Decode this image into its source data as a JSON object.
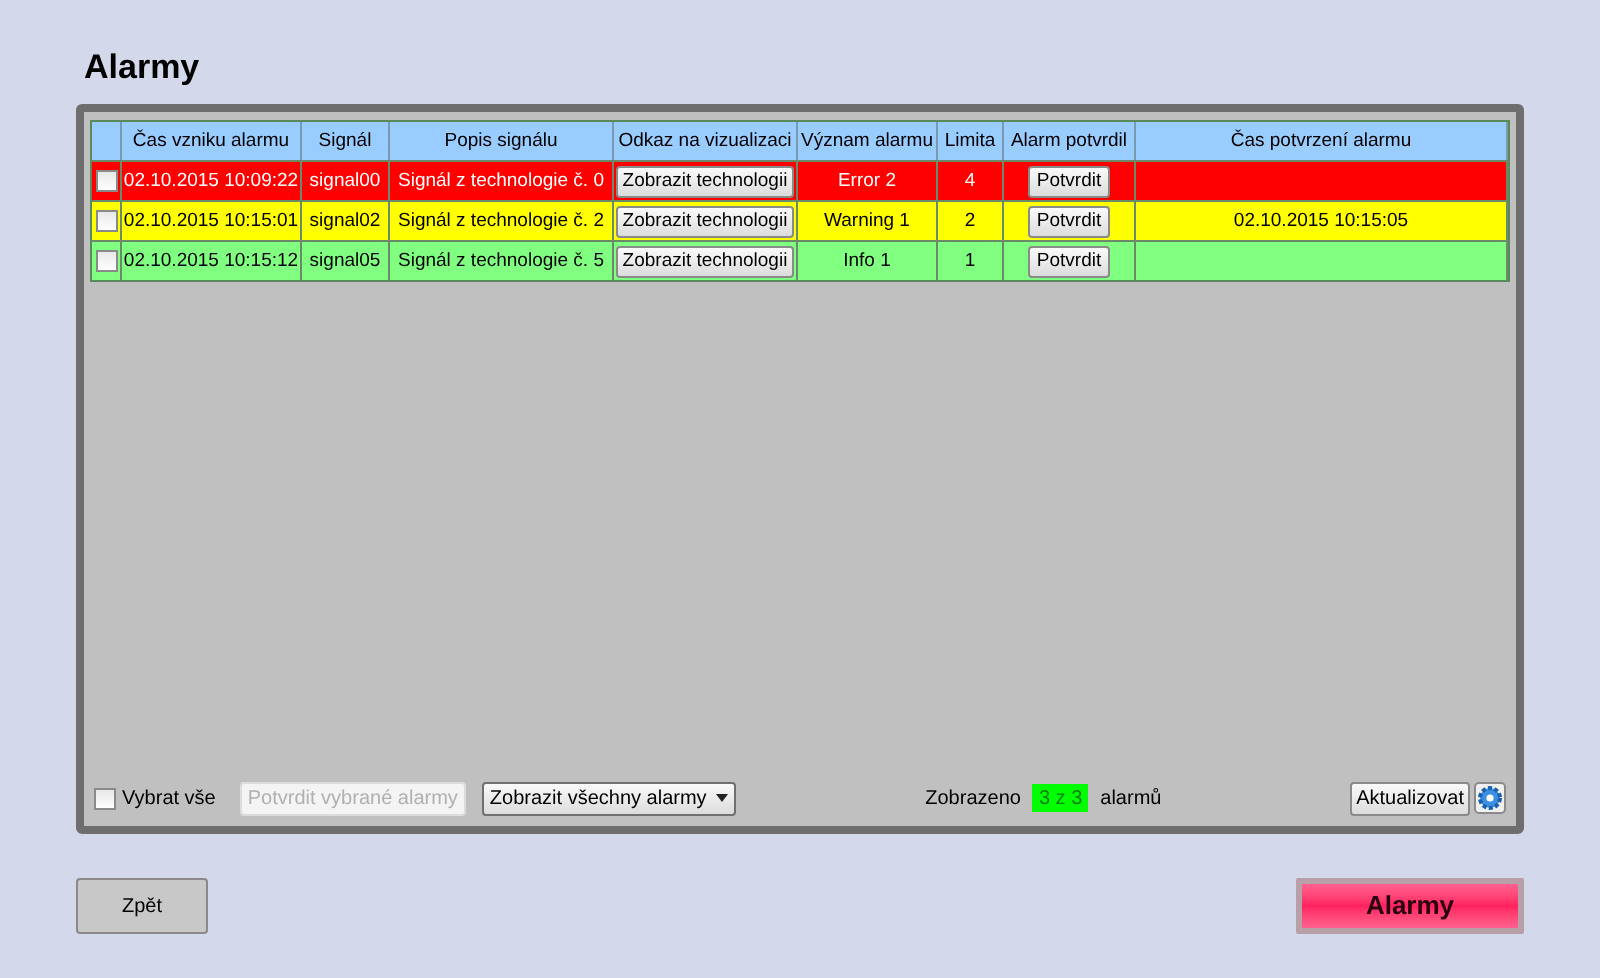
{
  "title": "Alarmy",
  "table": {
    "columns": [
      "Čas vzniku alarmu",
      "Signál",
      "Popis signálu",
      "Odkaz na vizualizaci",
      "Význam alarmu",
      "Limita",
      "Alarm potvrdil",
      "Čas potvrzení alarmu"
    ],
    "rows": [
      {
        "checked": false,
        "color": "#ff0000",
        "time": "02.10.2015 10:09:22",
        "signal": "signal00",
        "description": "Signál z technologie č. 0",
        "link": "Zobrazit technologii",
        "meaning": "Error 2",
        "limit": "4",
        "confirm": "Potvrdit",
        "confirmed_time": ""
      },
      {
        "checked": false,
        "color": "#ffff00",
        "time": "02.10.2015 10:15:01",
        "signal": "signal02",
        "description": "Signál z technologie č. 2",
        "link": "Zobrazit technologii",
        "meaning": "Warning 1",
        "limit": "2",
        "confirm": "Potvrdit",
        "confirmed_time": "02.10.2015 10:15:05"
      },
      {
        "checked": false,
        "color": "#80ff80",
        "time": "02.10.2015 10:15:12",
        "signal": "signal05",
        "description": "Signál z technologie č. 5",
        "link": "Zobrazit technologii",
        "meaning": "Info 1",
        "limit": "1",
        "confirm": "Potvrdit",
        "confirmed_time": ""
      }
    ]
  },
  "footer": {
    "select_all": {
      "label": "Vybrat vše",
      "checked": false
    },
    "confirm_selected": {
      "label": "Potvrdit vybrané alarmy",
      "disabled": true
    },
    "filter": "Zobrazit všechny alarmy",
    "shown_prefix": "Zobrazeno",
    "shown_count": "3 z 3",
    "shown_suffix": "alarmů",
    "refresh": "Aktualizovat"
  },
  "buttons": {
    "back": "Zpět",
    "alarms": "Alarmy"
  }
}
